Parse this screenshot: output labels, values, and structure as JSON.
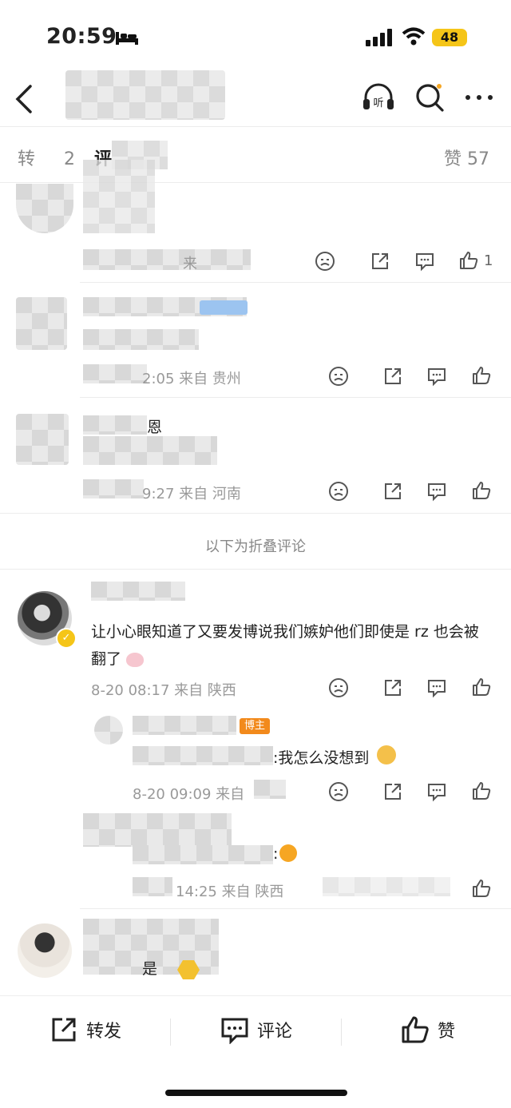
{
  "status": {
    "time": "20:59",
    "battery": "48"
  },
  "tabs": {
    "repost_prefix": "转",
    "repost_count": "2",
    "comment_prefix": "评",
    "likes_label": "赞 57"
  },
  "comments": [
    {
      "meta": "来",
      "like_count": "1"
    },
    {
      "meta": "2:05 来自 贵州"
    },
    {
      "line1": "恩",
      "meta": "9:27 来自 河南"
    }
  ],
  "fold_note": "以下为折叠评论",
  "folded": {
    "main": {
      "text": "让小心眼知道了又要发博说我们嫉妒他们即使是 rz 也会被翻了",
      "meta": "8-20 08:17 来自 陕西"
    },
    "reply1": {
      "badge": "博主",
      "text": ":我怎么没想到",
      "meta": "8-20 09:09 来自"
    },
    "reply2": {
      "text": ":",
      "meta": "14:25 来自 陕西"
    },
    "last": {
      "text": "是"
    }
  },
  "bottom": {
    "repost": "转发",
    "comment": "评论",
    "like": "赞"
  },
  "colors": {
    "accent": "#f5c518",
    "badge": "#f28a1c"
  }
}
